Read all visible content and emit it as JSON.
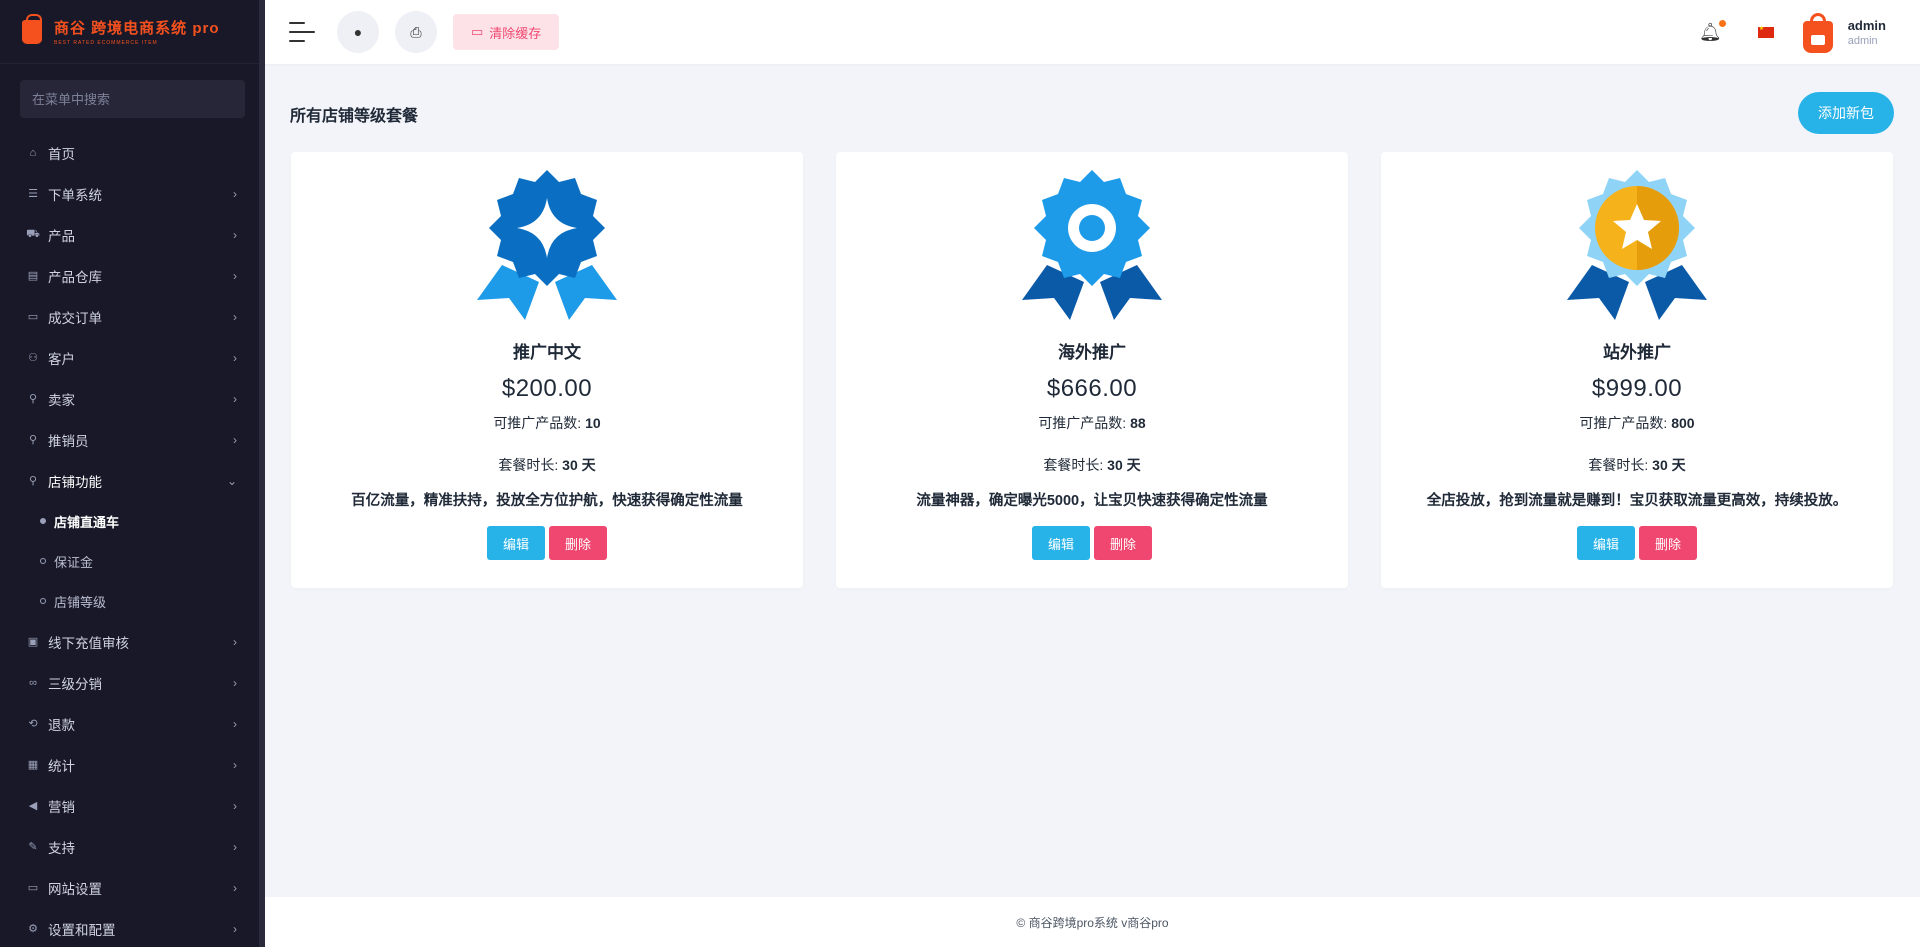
{
  "app": {
    "brand_main": "商谷 跨境电商系统 pro",
    "brand_sub": "BEST RATED ECOMMERCE ITEM"
  },
  "sidebar": {
    "search_placeholder": "在菜单中搜索",
    "items": [
      {
        "label": "首页",
        "icon": "home-icon"
      },
      {
        "label": "下单系统",
        "icon": "list-icon"
      },
      {
        "label": "产品",
        "icon": "cart-icon"
      },
      {
        "label": "产品仓库",
        "icon": "warehouse-icon"
      },
      {
        "label": "成交订单",
        "icon": "order-icon"
      },
      {
        "label": "客户",
        "icon": "users-icon"
      },
      {
        "label": "卖家",
        "icon": "user-icon"
      },
      {
        "label": "推销员",
        "icon": "salesman-icon"
      },
      {
        "label": "店铺功能",
        "icon": "shop-icon"
      },
      {
        "label": "线下充值审核",
        "icon": "money-icon"
      },
      {
        "label": "三级分销",
        "icon": "link-icon"
      },
      {
        "label": "退款",
        "icon": "refund-icon"
      },
      {
        "label": "统计",
        "icon": "stats-icon"
      },
      {
        "label": "营销",
        "icon": "megaphone-icon"
      },
      {
        "label": "支持",
        "icon": "support-icon"
      },
      {
        "label": "网站设置",
        "icon": "monitor-icon"
      },
      {
        "label": "设置和配置",
        "icon": "gear-icon"
      }
    ],
    "submenu": [
      {
        "label": "店铺直通车"
      },
      {
        "label": "保证金"
      },
      {
        "label": "店铺等级"
      }
    ]
  },
  "topbar": {
    "clear_cache_label": "清除缓存",
    "user_name": "admin",
    "user_role": "admin"
  },
  "main": {
    "page_title": "所有店铺等级套餐",
    "add_button": "添加新包",
    "edit_label": "编辑",
    "delete_label": "删除",
    "products_label": "可推广产品数:",
    "duration_label": "套餐时长:",
    "cards": [
      {
        "name": "推广中文",
        "price": "$200.00",
        "products": "10",
        "duration": "30 天",
        "desc": "百亿流量，精准扶持，投放全方位护航，快速获得确定性流量",
        "badge": "diamond"
      },
      {
        "name": "海外推广",
        "price": "$666.00",
        "products": "88",
        "duration": "30 天",
        "desc": "流量神器，确定曝光5000，让宝贝快速获得确定性流量",
        "badge": "ring"
      },
      {
        "name": "站外推广",
        "price": "$999.00",
        "products": "800",
        "duration": "30 天",
        "desc": "全店投放，抢到流量就是赚到！宝贝获取流量更高效，持续投放。",
        "badge": "star"
      }
    ]
  },
  "footer": {
    "text": "© 商谷跨境pro系统 v商谷pro"
  },
  "colors": {
    "sidebar_bg": "#181828",
    "accent": "#27b3e8",
    "danger": "#ef476f",
    "brand": "#f4511e"
  }
}
